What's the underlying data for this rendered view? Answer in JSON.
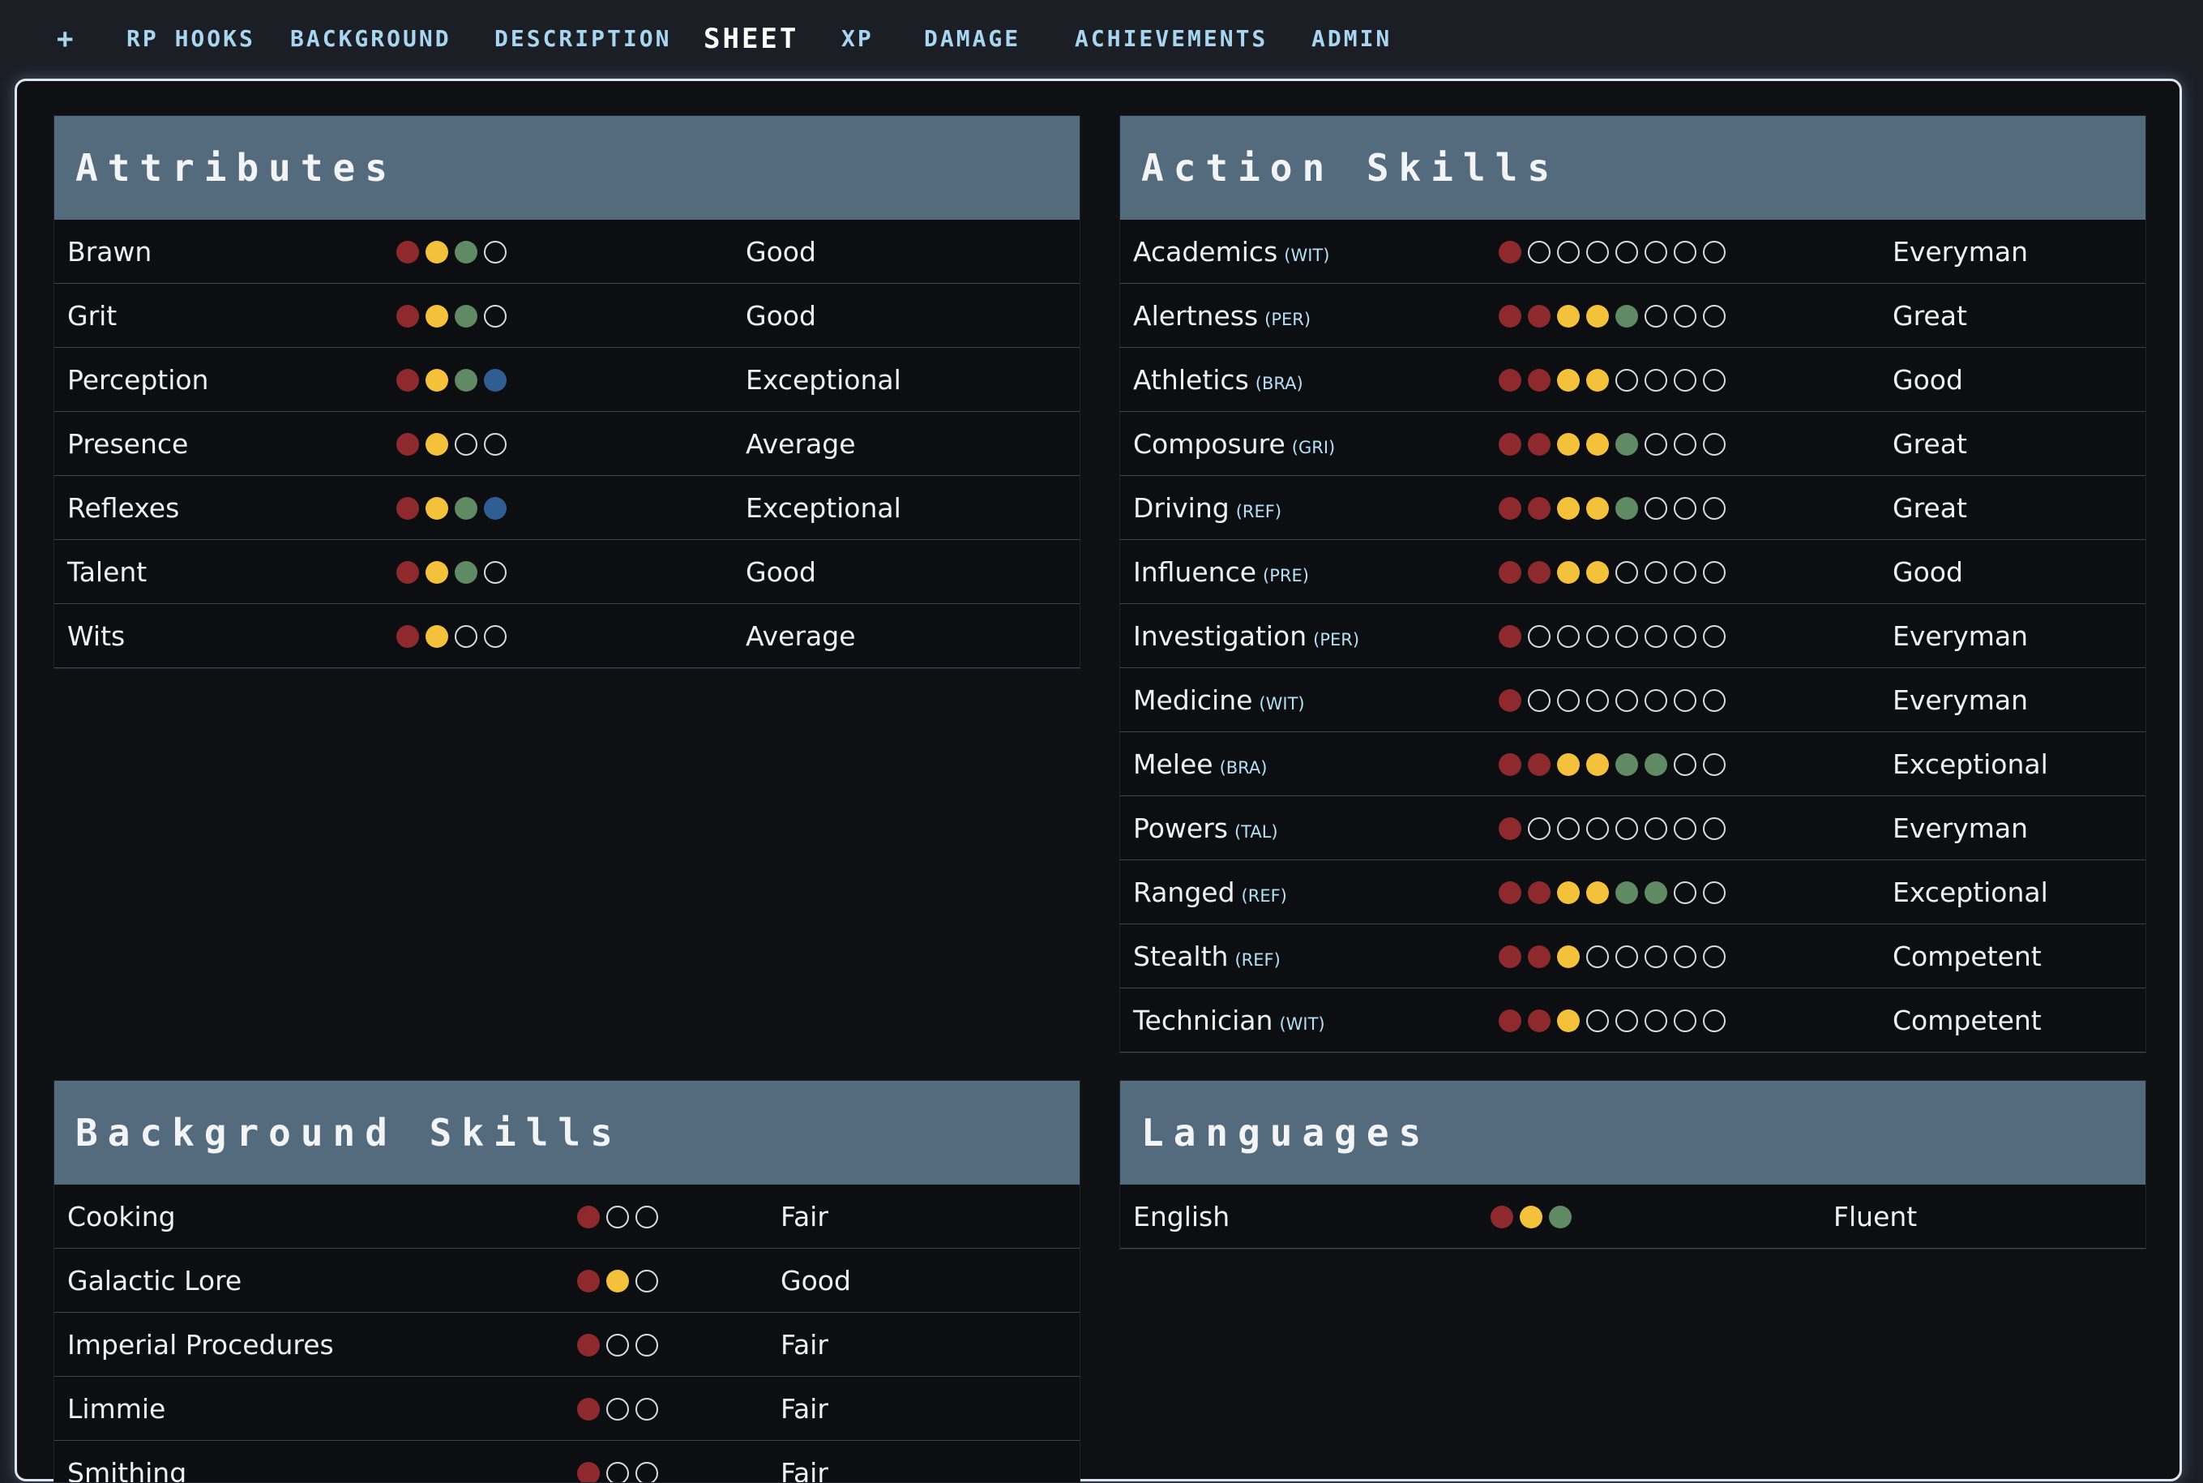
{
  "nav": {
    "add": "+",
    "tabs": [
      "RP HOOKS",
      "BACKGROUND",
      "DESCRIPTION",
      "SHEET",
      "XP",
      "DAMAGE",
      "ACHIEVEMENTS",
      "ADMIN"
    ],
    "active_tab": "SHEET"
  },
  "colors": {
    "dot_1": "#8e2a2e",
    "dot_2": "#f3c13a",
    "dot_3": "#5f8a63",
    "dot_4": "#2f5f92",
    "header_bg": "#546b7e",
    "nav_text": "#a8d6f0"
  },
  "attributes": {
    "title": "Attributes",
    "max": 4,
    "rows": [
      {
        "name": "Brawn",
        "level": 3,
        "rank": "Good"
      },
      {
        "name": "Grit",
        "level": 3,
        "rank": "Good"
      },
      {
        "name": "Perception",
        "level": 4,
        "rank": "Exceptional"
      },
      {
        "name": "Presence",
        "level": 2,
        "rank": "Average"
      },
      {
        "name": "Reflexes",
        "level": 4,
        "rank": "Exceptional"
      },
      {
        "name": "Talent",
        "level": 3,
        "rank": "Good"
      },
      {
        "name": "Wits",
        "level": 2,
        "rank": "Average"
      }
    ]
  },
  "action_skills": {
    "title": "Action Skills",
    "max": 8,
    "rows": [
      {
        "name": "Academics",
        "attr": "(WIT)",
        "level": 1,
        "rank": "Everyman"
      },
      {
        "name": "Alertness",
        "attr": "(PER)",
        "level": 5,
        "rank": "Great"
      },
      {
        "name": "Athletics",
        "attr": "(BRA)",
        "level": 4,
        "rank": "Good"
      },
      {
        "name": "Composure",
        "attr": "(GRI)",
        "level": 5,
        "rank": "Great"
      },
      {
        "name": "Driving",
        "attr": "(REF)",
        "level": 5,
        "rank": "Great"
      },
      {
        "name": "Influence",
        "attr": "(PRE)",
        "level": 4,
        "rank": "Good"
      },
      {
        "name": "Investigation",
        "attr": "(PER)",
        "level": 1,
        "rank": "Everyman"
      },
      {
        "name": "Medicine",
        "attr": "(WIT)",
        "level": 1,
        "rank": "Everyman"
      },
      {
        "name": "Melee",
        "attr": "(BRA)",
        "level": 6,
        "rank": "Exceptional"
      },
      {
        "name": "Powers",
        "attr": "(TAL)",
        "level": 1,
        "rank": "Everyman"
      },
      {
        "name": "Ranged",
        "attr": "(REF)",
        "level": 6,
        "rank": "Exceptional"
      },
      {
        "name": "Stealth",
        "attr": "(REF)",
        "level": 3,
        "rank": "Competent"
      },
      {
        "name": "Technician",
        "attr": "(WIT)",
        "level": 3,
        "rank": "Competent"
      }
    ]
  },
  "background_skills": {
    "title": "Background Skills",
    "max": 3,
    "rows": [
      {
        "name": "Cooking",
        "level": 1,
        "rank": "Fair"
      },
      {
        "name": "Galactic Lore",
        "level": 2,
        "rank": "Good"
      },
      {
        "name": "Imperial Procedures",
        "level": 1,
        "rank": "Fair"
      },
      {
        "name": "Limmie",
        "level": 1,
        "rank": "Fair"
      },
      {
        "name": "Smithing",
        "level": 1,
        "rank": "Fair"
      }
    ]
  },
  "languages": {
    "title": "Languages",
    "max": 3,
    "rows": [
      {
        "name": "English",
        "level": 3,
        "rank": "Fluent"
      }
    ]
  }
}
